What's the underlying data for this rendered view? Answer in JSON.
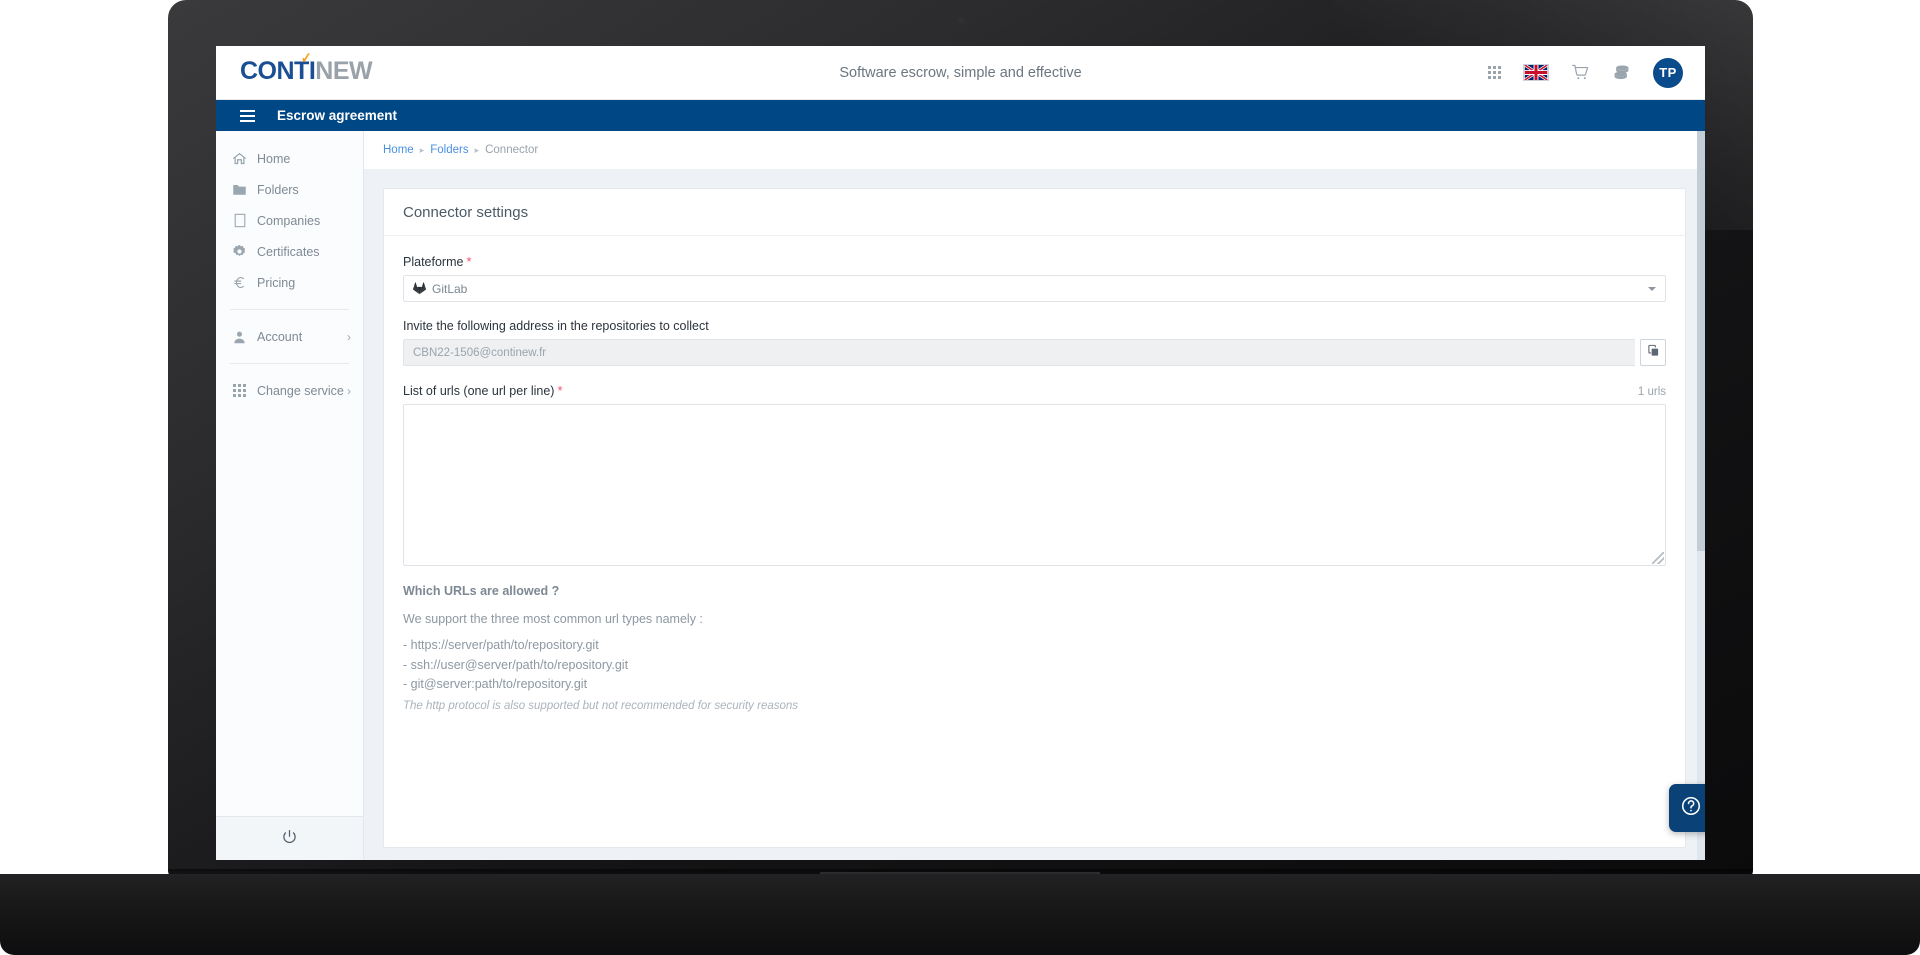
{
  "header": {
    "logo_primary": "CONTI",
    "logo_secondary": "NEW",
    "logo_check": "✓",
    "tagline": "Software escrow, simple and effective",
    "icons": {
      "apps": "apps-grid-icon",
      "language": "uk-flag-icon",
      "cart": "shopping-cart-icon",
      "credits": "coins-stack-icon"
    },
    "avatar_initials": "TP"
  },
  "navbar": {
    "menu_icon": "hamburger-menu-icon",
    "title": "Escrow agreement",
    "color": "#004785"
  },
  "sidebar": {
    "items": [
      {
        "label": "Home",
        "icon": "home-icon",
        "chevron": ""
      },
      {
        "label": "Folders",
        "icon": "folder-icon",
        "chevron": ""
      },
      {
        "label": "Companies",
        "icon": "building-icon",
        "chevron": ""
      },
      {
        "label": "Certificates",
        "icon": "certificate-badge-icon",
        "chevron": ""
      },
      {
        "label": "Pricing",
        "icon": "euro-icon",
        "chevron": ""
      }
    ],
    "items_secondary": [
      {
        "label": "Account",
        "icon": "person-icon",
        "chevron": "›"
      }
    ],
    "items_tertiary": [
      {
        "label": "Change service",
        "icon": "apps-grid-icon",
        "chevron": "›"
      }
    ],
    "footer_icon": "power-logout-icon"
  },
  "breadcrumb": {
    "home": "Home",
    "folders": "Folders",
    "current": "Connector",
    "separator": "▸"
  },
  "card": {
    "title": "Connector settings",
    "platform": {
      "label": "Plateforme",
      "required": "*",
      "value": "GitLab",
      "icon": "gitlab-fox-icon"
    },
    "invite": {
      "label": "Invite the following address in the repositories to collect",
      "value": "CBN22-1506@continew.fr",
      "copy_icon": "copy-icon"
    },
    "urls": {
      "label": "List of urls (one url per line)",
      "required": "*",
      "counter": "1 urls",
      "value": "",
      "placeholder": ""
    },
    "help": {
      "title": "Which URLs are allowed ?",
      "intro": "We support the three most common url types namely :",
      "lines": [
        "- https://server/path/to/repository.git",
        "- ssh://user@server/path/to/repository.git",
        "- git@server:path/to/repository.git"
      ],
      "note": "The http protocol is also supported but not recommended for security reasons"
    }
  },
  "help_fab": {
    "icon": "question-mark-circle-icon"
  },
  "colors": {
    "nav_blue": "#004785",
    "link_blue": "#4a90e2",
    "required_red": "#f4516c",
    "logo_blue": "#1b4f93",
    "logo_gray": "#9aa2a9",
    "logo_orange": "#f5a11b"
  }
}
